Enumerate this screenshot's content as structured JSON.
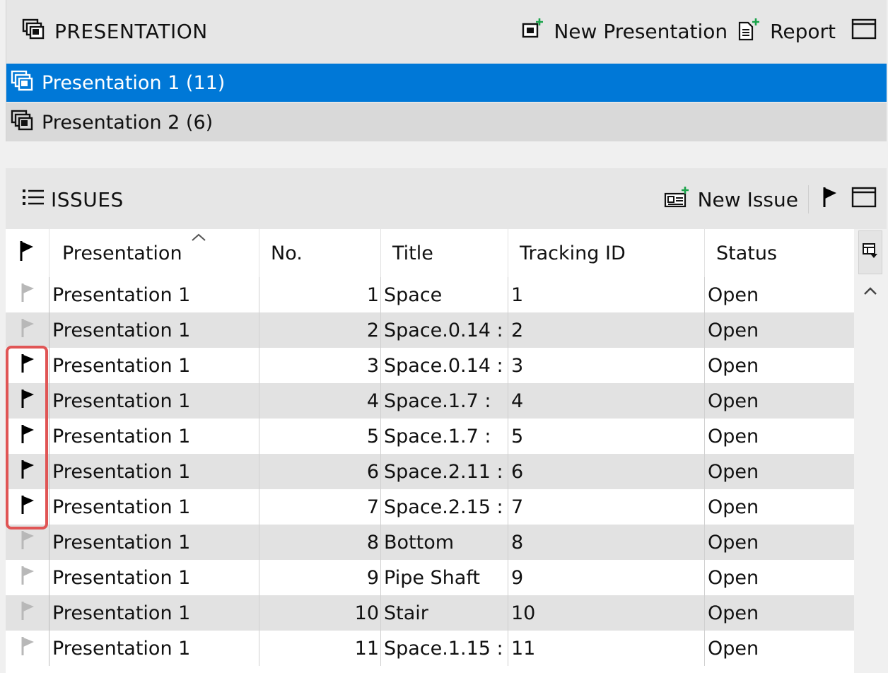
{
  "presentation_panel": {
    "title": "PRESENTATION",
    "new_presentation_label": "New Presentation",
    "report_label": "Report",
    "items": [
      {
        "label": "Presentation 1 (11)",
        "selected": true
      },
      {
        "label": "Presentation 2 (6)",
        "selected": false
      }
    ]
  },
  "issues_panel": {
    "title": "ISSUES",
    "new_issue_label": "New Issue",
    "columns": {
      "presentation": "Presentation",
      "no": "No.",
      "title": "Title",
      "tracking_id": "Tracking ID",
      "status": "Status"
    },
    "rows": [
      {
        "flagged": false,
        "presentation": "Presentation 1",
        "no": "1",
        "title": "Space",
        "tracking_id": "1",
        "status": "Open"
      },
      {
        "flagged": false,
        "presentation": "Presentation 1",
        "no": "2",
        "title": "Space.0.14 :",
        "tracking_id": "2",
        "status": "Open"
      },
      {
        "flagged": true,
        "presentation": "Presentation 1",
        "no": "3",
        "title": "Space.0.14 :",
        "tracking_id": "3",
        "status": "Open"
      },
      {
        "flagged": true,
        "presentation": "Presentation 1",
        "no": "4",
        "title": "Space.1.7 :",
        "tracking_id": "4",
        "status": "Open"
      },
      {
        "flagged": true,
        "presentation": "Presentation 1",
        "no": "5",
        "title": "Space.1.7 :",
        "tracking_id": "5",
        "status": "Open"
      },
      {
        "flagged": true,
        "presentation": "Presentation 1",
        "no": "6",
        "title": "Space.2.11 :",
        "tracking_id": "6",
        "status": "Open"
      },
      {
        "flagged": true,
        "presentation": "Presentation 1",
        "no": "7",
        "title": "Space.2.15 :",
        "tracking_id": "7",
        "status": "Open"
      },
      {
        "flagged": false,
        "presentation": "Presentation 1",
        "no": "8",
        "title": "Bottom",
        "tracking_id": "8",
        "status": "Open"
      },
      {
        "flagged": false,
        "presentation": "Presentation 1",
        "no": "9",
        "title": "Pipe Shaft",
        "tracking_id": "9",
        "status": "Open"
      },
      {
        "flagged": false,
        "presentation": "Presentation 1",
        "no": "10",
        "title": "Stair",
        "tracking_id": "10",
        "status": "Open"
      },
      {
        "flagged": false,
        "presentation": "Presentation 1",
        "no": "11",
        "title": "Space.1.15 :",
        "tracking_id": "11",
        "status": "Open"
      }
    ]
  },
  "colors": {
    "selection": "#0078d7",
    "flag_on": "#000000",
    "flag_off": "#b8b8b8",
    "add_plus": "#1aa34a",
    "highlight": "#e05555"
  }
}
